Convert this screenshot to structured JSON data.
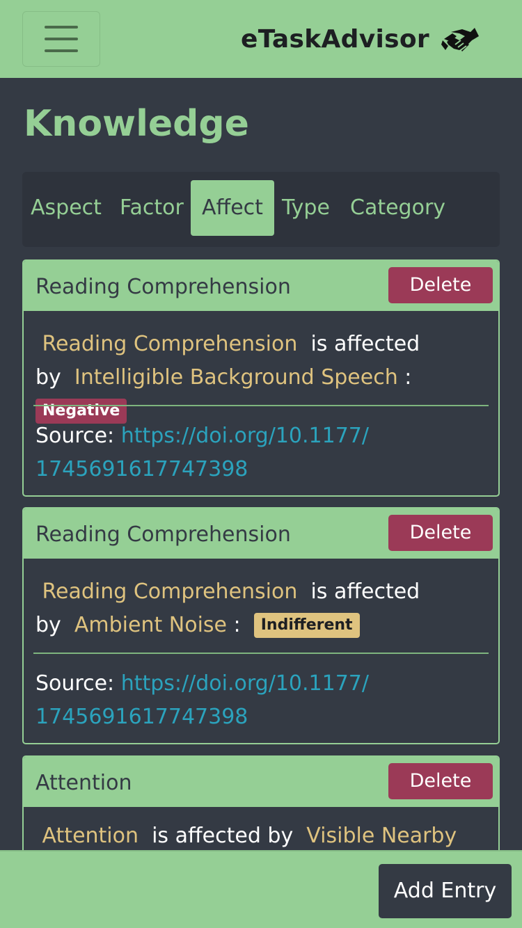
{
  "navbar": {
    "brand": "eTaskAdvisor",
    "menu_icon": "hamburger-menu-icon",
    "brand_icon": "handshake-icon"
  },
  "page": {
    "title": "Knowledge"
  },
  "tabs": [
    {
      "label": "Aspect",
      "active": false
    },
    {
      "label": "Factor",
      "active": false
    },
    {
      "label": "Affect",
      "active": true
    },
    {
      "label": "Type",
      "active": false
    },
    {
      "label": "Category",
      "active": false
    }
  ],
  "cards": [
    {
      "title": "Reading Comprehension",
      "delete_label": "Delete",
      "subject": "Reading Comprehension",
      "connector_1": "is affected",
      "connector_2": "by",
      "factor": "Intelligible Background Speech",
      "colon": ":",
      "effect": "Negative",
      "source_label": "Source:",
      "source_url_line1": "https://doi.org/10.1177/",
      "source_url_line2": "1745691617747398"
    },
    {
      "title": "Reading Comprehension",
      "delete_label": "Delete",
      "subject": "Reading Comprehension",
      "connector_1": "is affected",
      "connector_2": "by",
      "factor": "Ambient Noise",
      "colon": ":",
      "effect": "Indifferent",
      "source_label": "Source:",
      "source_url_line1": "https://doi.org/10.1177/",
      "source_url_line2": "1745691617747398"
    },
    {
      "title": "Attention",
      "delete_label": "Delete",
      "subject": "Attention",
      "connector_1": "is affected by",
      "factor": "Visible Nearby"
    }
  ],
  "footer": {
    "add_label": "Add Entry"
  },
  "colors": {
    "accent_green": "#95cf95",
    "background": "#343a44",
    "danger": "#9b3a57",
    "highlight": "#dfc37f",
    "link": "#2ba3bd"
  }
}
